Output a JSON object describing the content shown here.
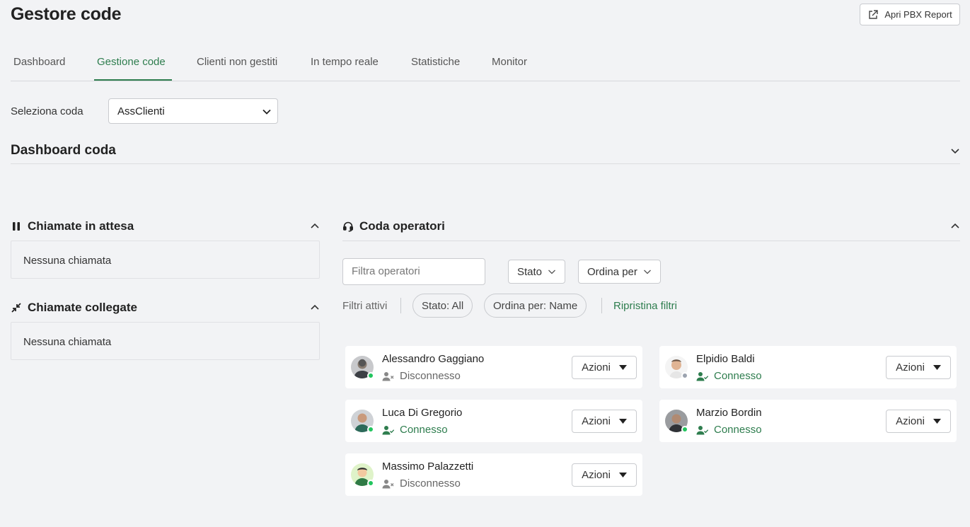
{
  "header": {
    "title": "Gestore code",
    "pbx_button": "Apri PBX Report"
  },
  "tabs": [
    {
      "label": "Dashboard",
      "active": false
    },
    {
      "label": "Gestione code",
      "active": true
    },
    {
      "label": "Clienti non gestiti",
      "active": false
    },
    {
      "label": "In tempo reale",
      "active": false
    },
    {
      "label": "Statistiche",
      "active": false
    },
    {
      "label": "Monitor",
      "active": false
    }
  ],
  "queue_select": {
    "label": "Seleziona coda",
    "value": "AssClienti"
  },
  "dashboard_section": {
    "title": "Dashboard coda"
  },
  "waiting_calls": {
    "title": "Chiamate in attesa",
    "empty_text": "Nessuna chiamata"
  },
  "connected_calls": {
    "title": "Chiamate collegate",
    "empty_text": "Nessuna chiamata"
  },
  "operators": {
    "title": "Coda operatori",
    "filter_placeholder": "Filtra operatori",
    "stato_dropdown": "Stato",
    "order_dropdown": "Ordina per",
    "active_filters_label": "Filtri attivi",
    "chips": [
      "Stato: All",
      "Ordina per: Name"
    ],
    "reset_label": "Ripristina filtri",
    "actions_label": "Azioni",
    "list": [
      {
        "name": "Alessandro Gaggiano",
        "status": "Disconnesso",
        "online": true
      },
      {
        "name": "Elpidio Baldi",
        "status": "Connesso",
        "online": false
      },
      {
        "name": "Luca Di Gregorio",
        "status": "Connesso",
        "online": true
      },
      {
        "name": "Marzio Bordin",
        "status": "Connesso",
        "online": true
      },
      {
        "name": "Massimo Palazzetti",
        "status": "Disconnesso",
        "online": true
      }
    ]
  },
  "colors": {
    "accent": "#2e7d4e",
    "online_dot": "#22c55e",
    "offline_dot": "#9ca3af",
    "background": "#f2f3f5"
  }
}
